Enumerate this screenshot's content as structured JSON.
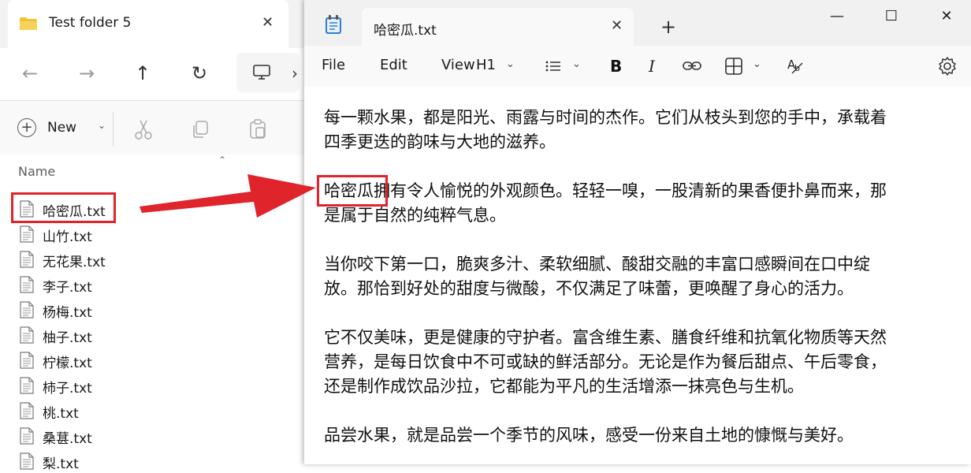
{
  "explorer": {
    "tab_title": "Test folder 5",
    "tab_close": "✕",
    "nav": {
      "back": "←",
      "forward": "→",
      "up": "↑",
      "refresh": "↻",
      "more": "›"
    },
    "new_label": "New",
    "new_caret": "⌄",
    "column_name": "Name",
    "sort_caret": "⌃",
    "files": [
      "哈密瓜.txt",
      "山竹.txt",
      "无花果.txt",
      "李子.txt",
      "杨梅.txt",
      "柚子.txt",
      "柠檬.txt",
      "柿子.txt",
      "桃.txt",
      "桑葚.txt",
      "梨.txt"
    ]
  },
  "notepad": {
    "tab_title": "哈密瓜.txt",
    "tab_close": "✕",
    "new_tab": "+",
    "window_buttons": {
      "minimize": "—",
      "maximize": "☐",
      "close": "✕"
    },
    "menu": {
      "file": "File",
      "edit": "Edit",
      "view": "View",
      "heading": "H1"
    },
    "paragraphs": [
      "每一颗水果，都是阳光、雨露与时间的杰作。它们从枝头到您的手中，承载着\n四季更迭的韵味与大地的滋养。",
      "哈密瓜拥有令人愉悦的外观颜色。轻轻一嗅，一股清新的果香便扑鼻而来，那\n是属于自然的纯粹气息。",
      "当你咬下第一口，脆爽多汁、柔软细腻、酸甜交融的丰富口感瞬间在口中绽\n放。那恰到好处的甜度与微酸，不仅满足了味蕾，更唤醒了身心的活力。",
      "它不仅美味，更是健康的守护者。富含维生素、膳食纤维和抗氧化物质等天然\n营养，是每日饮食中不可或缺的鲜活部分。无论是作为餐后甜点、午后零食，\n还是制作成饮品沙拉，它都能为平凡的生活增添一抹亮色与生机。",
      "品尝水果，就是品尝一个季节的风味，感受一份来自土地的慷慨与美好。"
    ]
  },
  "colors": {
    "highlight": "#e0242c",
    "arrow": "#e0242c",
    "folder": "#f2c230"
  }
}
